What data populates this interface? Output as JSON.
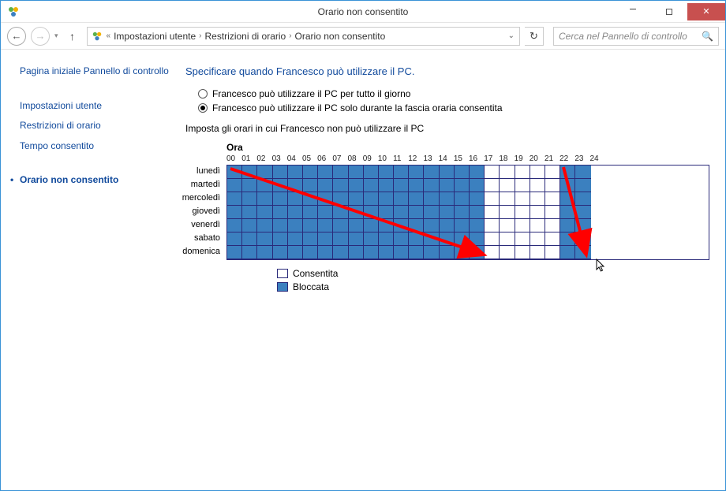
{
  "window": {
    "title": "Orario non consentito"
  },
  "titlebar": {
    "min": "—",
    "max": "▢",
    "close": "✕"
  },
  "nav": {
    "breadcrumb": [
      "Impostazioni utente",
      "Restrizioni di orario",
      "Orario non consentito"
    ],
    "search_placeholder": "Cerca nel Pannello di controllo"
  },
  "sidebar": {
    "home": "Pagina iniziale Pannello di controllo",
    "links": [
      "Impostazioni utente",
      "Restrizioni di orario",
      "Tempo consentito"
    ],
    "current": "Orario non consentito"
  },
  "main": {
    "heading": "Specificare quando Francesco può utilizzare il PC.",
    "radio1": "Francesco può utilizzare il PC per tutto il giorno",
    "radio2": "Francesco può utilizzare il PC solo durante la fascia oraria consentita",
    "instruction": "Imposta gli orari in cui Francesco non può utilizzare il PC",
    "hour_label": "Ora",
    "hours": [
      "00",
      "01",
      "02",
      "03",
      "04",
      "05",
      "06",
      "07",
      "08",
      "09",
      "10",
      "11",
      "12",
      "13",
      "14",
      "15",
      "16",
      "17",
      "18",
      "19",
      "20",
      "21",
      "22",
      "23",
      "24"
    ],
    "days": [
      "lunedì",
      "martedì",
      "mercoledì",
      "giovedì",
      "venerdì",
      "sabato",
      "domenica"
    ],
    "blocked_ranges": [
      [
        0,
        17
      ],
      [
        22,
        24
      ]
    ],
    "legend": {
      "allowed": "Consentita",
      "blocked": "Bloccata"
    }
  }
}
